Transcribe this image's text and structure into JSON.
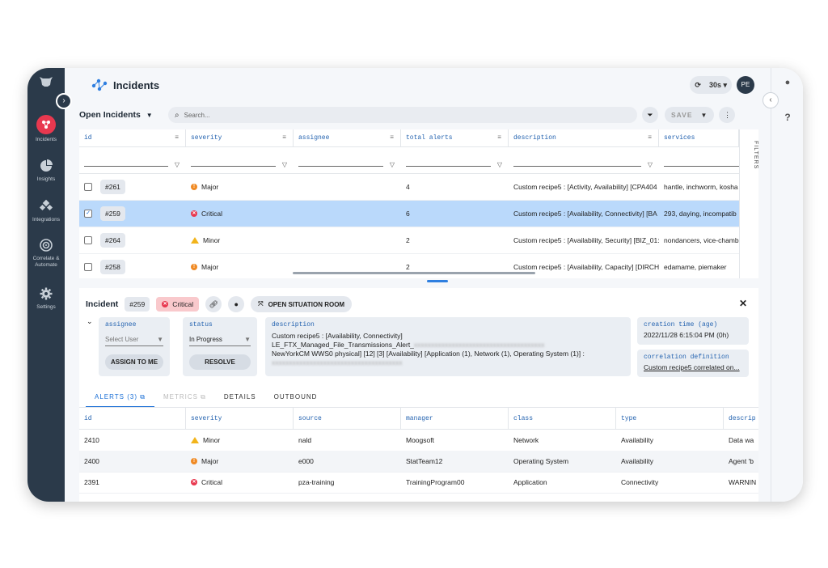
{
  "nav": {
    "items": [
      {
        "label": "Incidents",
        "icon": "incidents-icon"
      },
      {
        "label": "Insights",
        "icon": "pie-chart-icon"
      },
      {
        "label": "Integrations",
        "icon": "integrations-icon"
      },
      {
        "label": "Correlate & Automate",
        "icon": "correlate-icon"
      },
      {
        "label": "Settings",
        "icon": "gear-icon"
      }
    ]
  },
  "header": {
    "title": "Incidents",
    "refresh_interval": "30s ▾",
    "avatar_initials": "PE"
  },
  "toolbar": {
    "view_label": "Open Incidents",
    "search_placeholder": "Search...",
    "save_label": "SAVE"
  },
  "grid": {
    "columns": [
      "id",
      "severity",
      "assignee",
      "total alerts",
      "description",
      "services"
    ],
    "filters_label": "FILTERS",
    "rows": [
      {
        "id": "#261",
        "severity": "Major",
        "assignee": "",
        "total_alerts": "4",
        "description": "Custom recipe5 : [Activity, Availability] [CPA404",
        "services": "hantle, inchworm, kosha",
        "selected": false
      },
      {
        "id": "#259",
        "severity": "Critical",
        "assignee": "",
        "total_alerts": "6",
        "description": "Custom recipe5 : [Availability, Connectivity] [BA",
        "services": "293, daying, incompatib",
        "selected": true
      },
      {
        "id": "#264",
        "severity": "Minor",
        "assignee": "",
        "total_alerts": "2",
        "description": "Custom recipe5 : [Availability, Security] [BIZ_01:",
        "services": "nondancers, vice-chamb",
        "selected": false
      },
      {
        "id": "#258",
        "severity": "Major",
        "assignee": "",
        "total_alerts": "2",
        "description": "Custom recipe5 : [Availability, Capacity] [DIRCH",
        "services": "edamame, piemaker",
        "selected": false
      }
    ]
  },
  "detail": {
    "label": "Incident",
    "id": "#259",
    "severity": "Critical",
    "open_room_label": "OPEN SITUATION ROOM",
    "assignee_title": "assignee",
    "assignee_placeholder": "Select User",
    "assign_button": "ASSIGN TO ME",
    "status_title": "status",
    "status_value": "In Progress",
    "resolve_button": "RESOLVE",
    "description_title": "description",
    "description_line1": "Custom recipe5 : [Availability, Connectivity]",
    "description_line2": "LE_FTX_Managed_File_Transmissions_Alert_",
    "description_line3": "NewYorkCM WWS0 physical] [12] [3] [Availability] [Application (1), Network (1), Operating System (1)] :",
    "creation_title": "creation time (age)",
    "creation_value": "2022/11/28 6:15:04 PM (0h)",
    "correlation_title": "correlation definition",
    "correlation_value": "Custom recipe5 correlated on..."
  },
  "tabs": [
    {
      "label": "ALERTS (3)"
    },
    {
      "label": "METRICS"
    },
    {
      "label": "DETAILS"
    },
    {
      "label": "OUTBOUND"
    }
  ],
  "alerts": {
    "columns": [
      "id",
      "severity",
      "source",
      "manager",
      "class",
      "type",
      "descrip"
    ],
    "rows": [
      {
        "id": "2410",
        "severity": "Minor",
        "source": "nald",
        "manager": "Moogsoft",
        "class": "Network",
        "type": "Availability",
        "desc": "Data wa"
      },
      {
        "id": "2400",
        "severity": "Major",
        "source": "e000",
        "manager": "StatTeam12",
        "class": "Operating System",
        "type": "Availability",
        "desc": "Agent 'b"
      },
      {
        "id": "2391",
        "severity": "Critical",
        "source": "pza-training",
        "manager": "TrainingProgram00",
        "class": "Application",
        "type": "Connectivity",
        "desc": "WARNIN"
      }
    ]
  },
  "colors": {
    "nav_bg": "#2b3a4a",
    "accent": "#1a6fd6",
    "critical": "#e8384f",
    "major": "#f08a24",
    "minor": "#f2b41b",
    "selected_row": "#bad9fb"
  }
}
